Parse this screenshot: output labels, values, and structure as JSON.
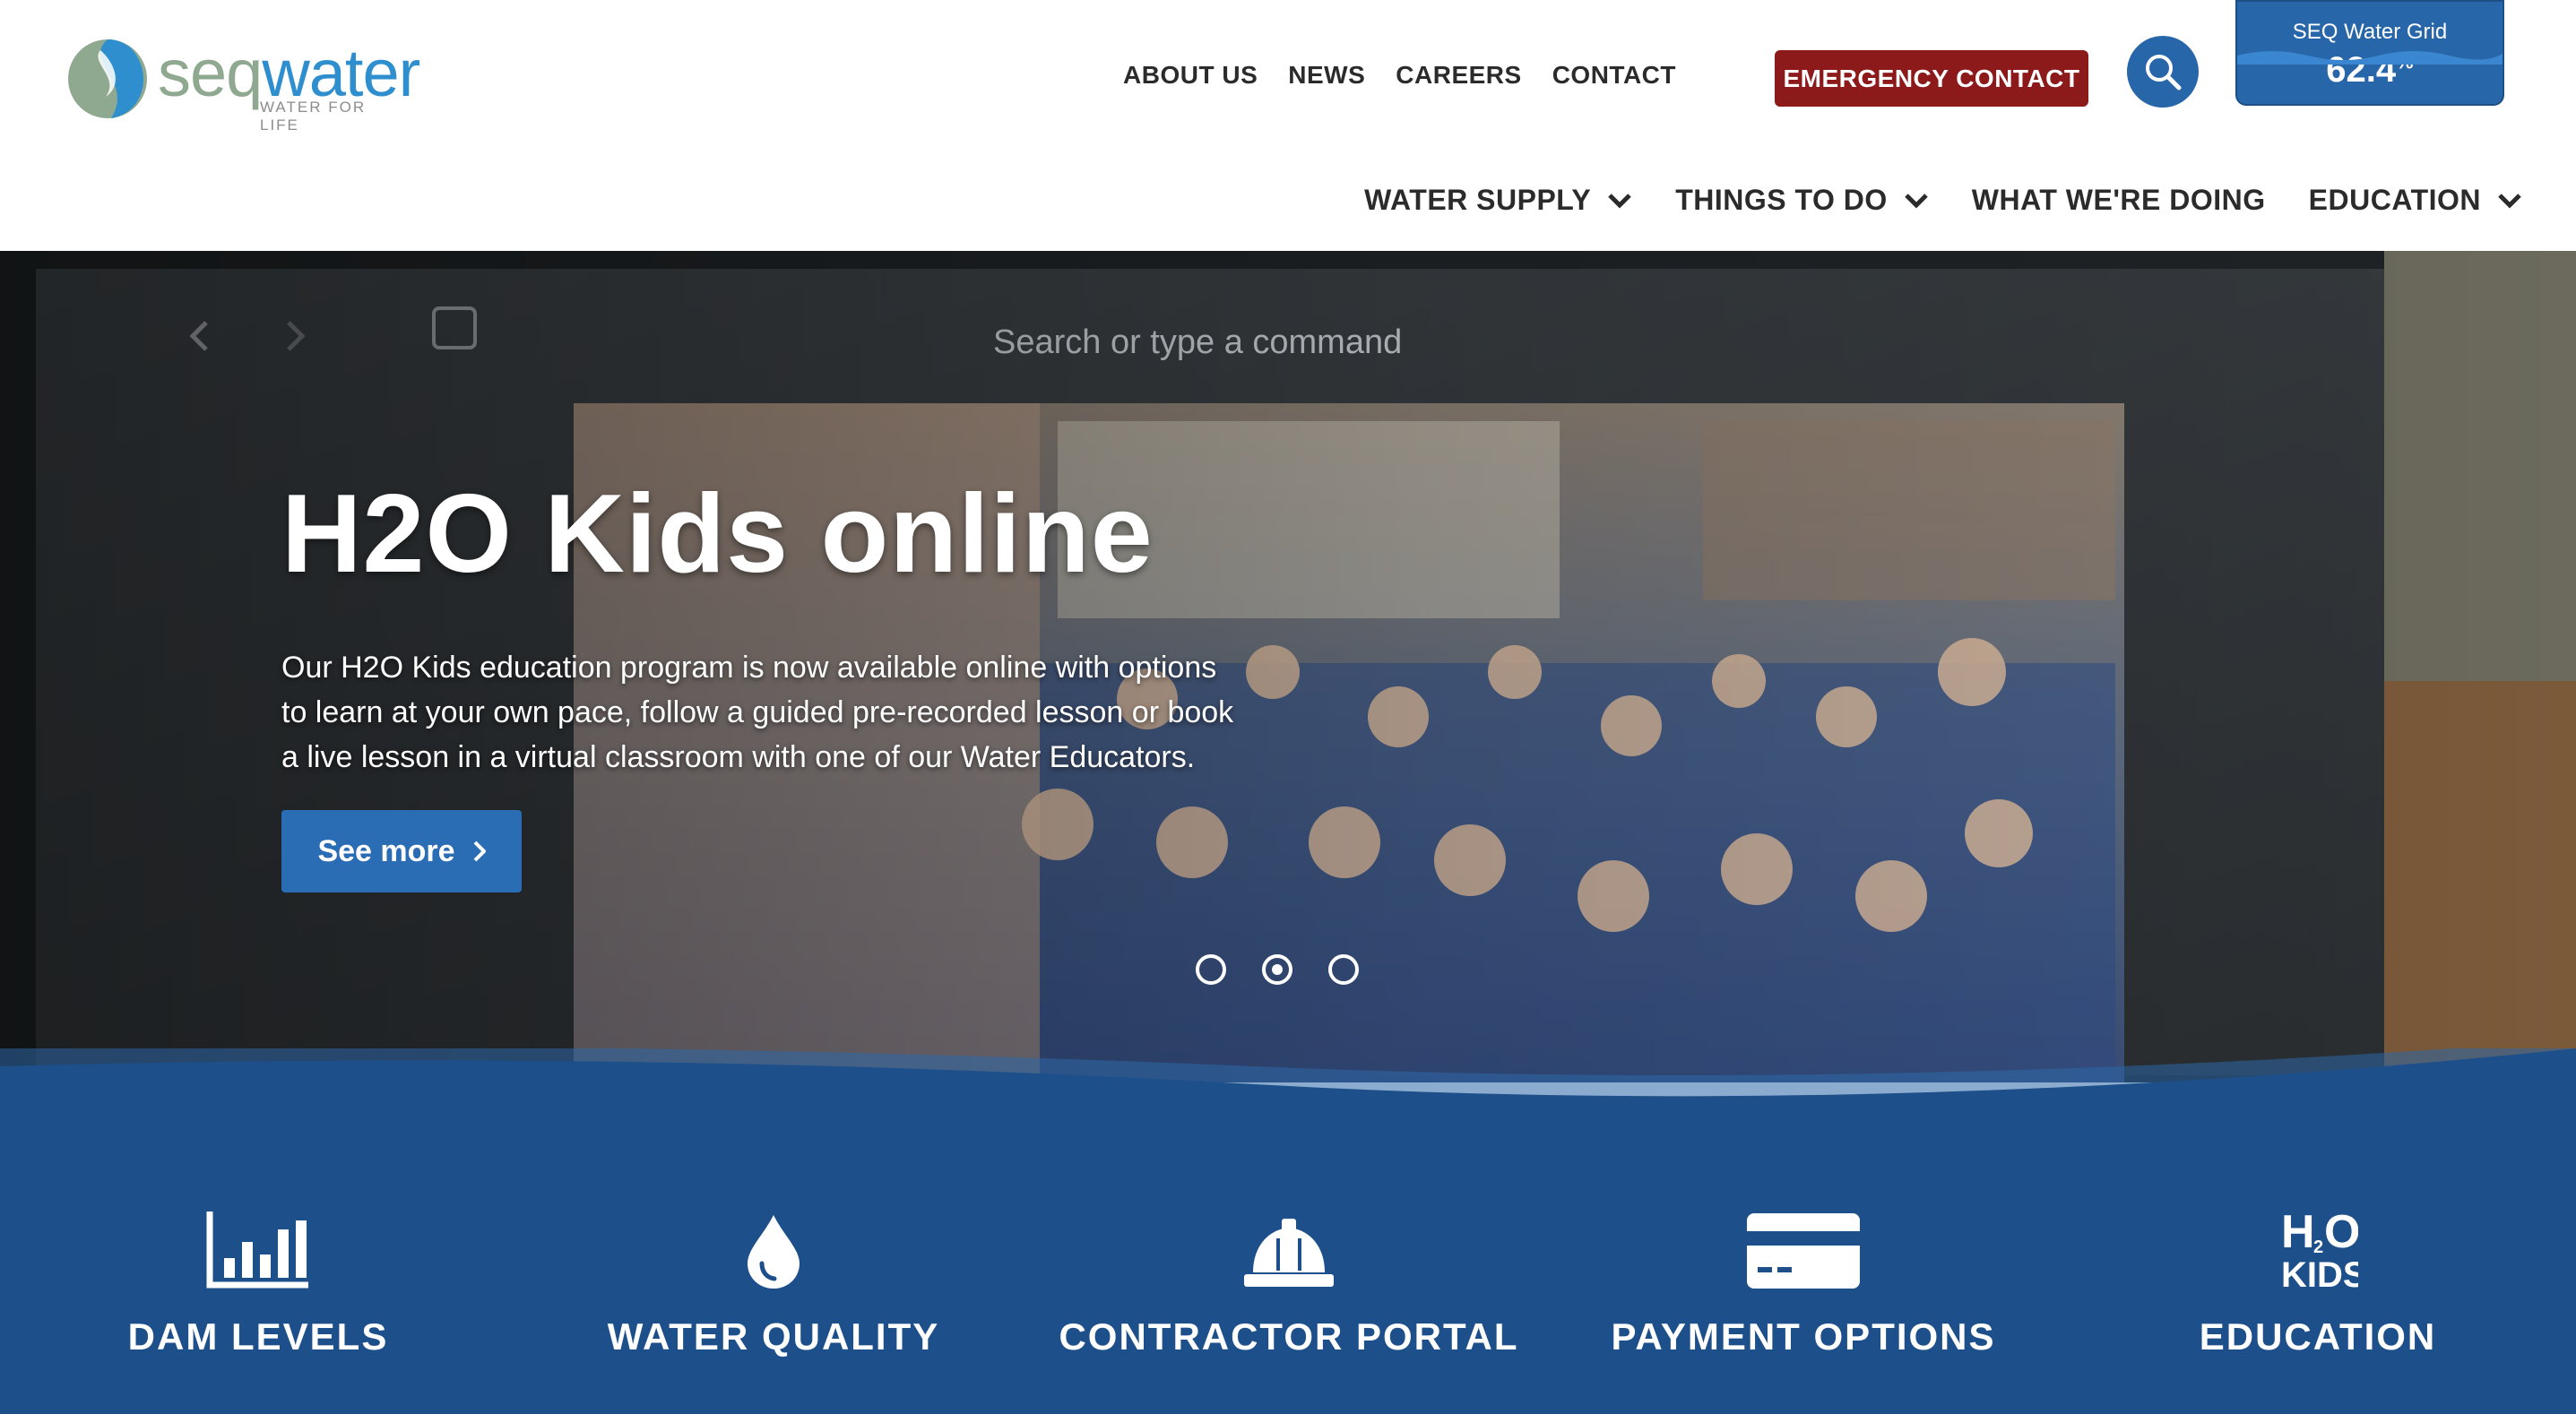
{
  "brand": {
    "logo_word_a": "seq",
    "logo_word_b": "water",
    "tagline": "WATER FOR LIFE"
  },
  "top_nav": {
    "items": [
      "ABOUT US",
      "NEWS",
      "CAREERS",
      "CONTACT"
    ],
    "emergency_label": "EMERGENCY CONTACT"
  },
  "water_grid": {
    "label": "SEQ Water Grid",
    "value": "62.4",
    "unit": "%"
  },
  "main_nav": {
    "items": [
      {
        "label": "WATER SUPPLY",
        "has_dropdown": true
      },
      {
        "label": "THINGS TO DO",
        "has_dropdown": true
      },
      {
        "label": "WHAT WE'RE DOING",
        "has_dropdown": false
      },
      {
        "label": "EDUCATION",
        "has_dropdown": true
      }
    ]
  },
  "hero": {
    "title": "H2O Kids online",
    "body": "Our H2O Kids education program is now available online with options to learn at your own pace, follow a guided pre-recorded lesson or book a live lesson in a virtual classroom with one of our Water Educators.",
    "cta": "See more",
    "slide_count": 3,
    "active_slide": 2
  },
  "quick_links": [
    {
      "label": "DAM LEVELS",
      "icon": "bar-chart-icon"
    },
    {
      "label": "WATER QUALITY",
      "icon": "water-drop-icon"
    },
    {
      "label": "CONTRACTOR PORTAL",
      "icon": "hard-hat-icon"
    },
    {
      "label": "PAYMENT OPTIONS",
      "icon": "credit-card-icon"
    },
    {
      "label": "EDUCATION",
      "icon": "h2o-kids-icon"
    }
  ],
  "colors": {
    "primary_blue": "#2766a8",
    "band_blue": "#1d4f8a",
    "emergency_red": "#8c1a1a",
    "logo_green": "#8fa890",
    "logo_blue": "#2f8fce"
  }
}
